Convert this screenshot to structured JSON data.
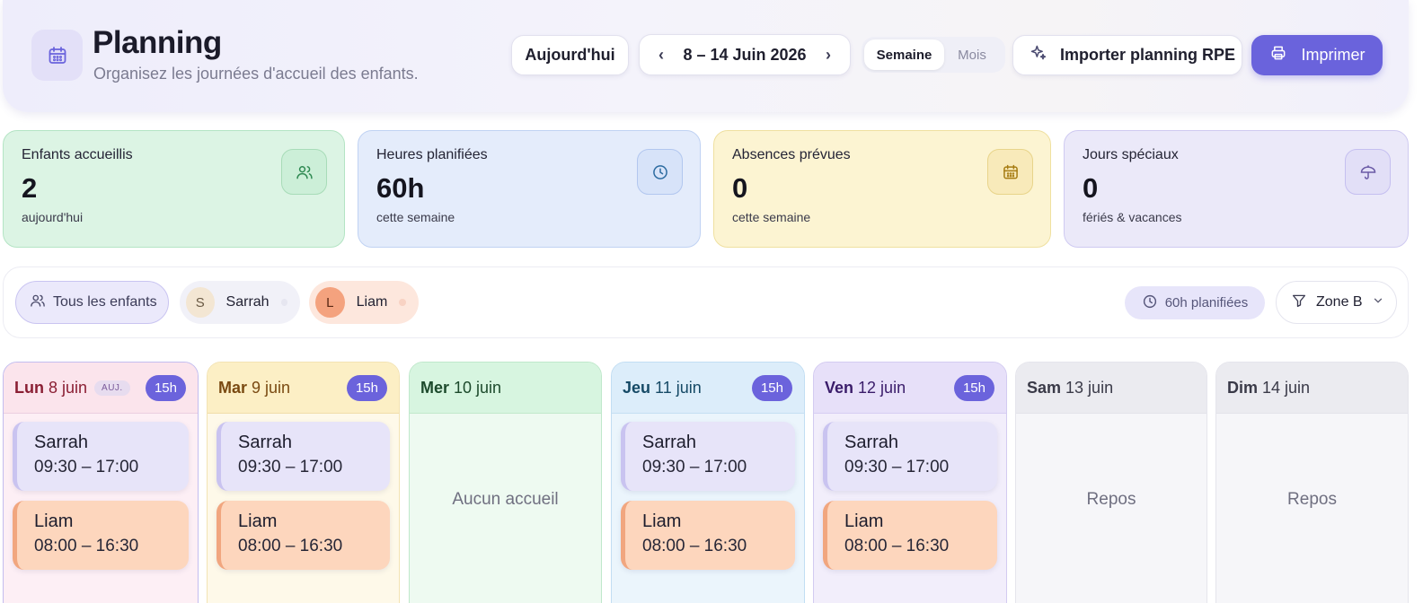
{
  "header": {
    "title": "Planning",
    "subtitle": "Organisez les journées d'accueil des enfants.",
    "today_label": "Aujourd'hui",
    "date_range": "8 – 14 Juin 2026",
    "view_options": [
      "Semaine",
      "Mois"
    ],
    "active_view": "Semaine",
    "import_label": "Importer planning RPE",
    "print_label": "Imprimer",
    "icons": {
      "app": "calendar-icon",
      "prev": "chevron-left-icon",
      "next": "chevron-right-icon",
      "import": "sparkle-icon",
      "print": "printer-icon"
    }
  },
  "stats": [
    {
      "label": "Enfants accueillis",
      "value": "2",
      "sub": "aujourd'hui",
      "icon": "users-icon"
    },
    {
      "label": "Heures planifiées",
      "value": "60h",
      "sub": "cette semaine",
      "icon": "clock-icon"
    },
    {
      "label": "Absences prévues",
      "value": "0",
      "sub": "cette semaine",
      "icon": "calendar-icon"
    },
    {
      "label": "Jours spéciaux",
      "value": "0",
      "sub": "fériés & vacances",
      "icon": "umbrella-icon"
    }
  ],
  "filters": {
    "all_label": "Tous les enfants",
    "children": [
      {
        "initial": "S",
        "name": "Sarrah"
      },
      {
        "initial": "L",
        "name": "Liam"
      }
    ],
    "hours_pill": "60h planifiées",
    "zone": "Zone B"
  },
  "days": [
    {
      "name": "Lun",
      "date": "8 juin",
      "today_badge": "AUJ.",
      "hours": "15h",
      "entries": [
        {
          "child": "Sarrah",
          "time": "09:30 – 17:00"
        },
        {
          "child": "Liam",
          "time": "08:00 – 16:30"
        }
      ]
    },
    {
      "name": "Mar",
      "date": "9 juin",
      "hours": "15h",
      "entries": [
        {
          "child": "Sarrah",
          "time": "09:30 – 17:00"
        },
        {
          "child": "Liam",
          "time": "08:00 – 16:30"
        }
      ]
    },
    {
      "name": "Mer",
      "date": "10 juin",
      "empty_text": "Aucun accueil"
    },
    {
      "name": "Jeu",
      "date": "11 juin",
      "hours": "15h",
      "entries": [
        {
          "child": "Sarrah",
          "time": "09:30 – 17:00"
        },
        {
          "child": "Liam",
          "time": "08:00 – 16:30"
        }
      ]
    },
    {
      "name": "Ven",
      "date": "12 juin",
      "hours": "15h",
      "entries": [
        {
          "child": "Sarrah",
          "time": "09:30 – 17:00"
        },
        {
          "child": "Liam",
          "time": "08:00 – 16:30"
        }
      ]
    },
    {
      "name": "Sam",
      "date": "13 juin",
      "empty_text": "Repos"
    },
    {
      "name": "Dim",
      "date": "14 juin",
      "empty_text": "Repos"
    }
  ],
  "colors": {
    "accent": "#6a63dc",
    "sarrah": "#e7e4f9",
    "liam": "#fdd6bd"
  }
}
